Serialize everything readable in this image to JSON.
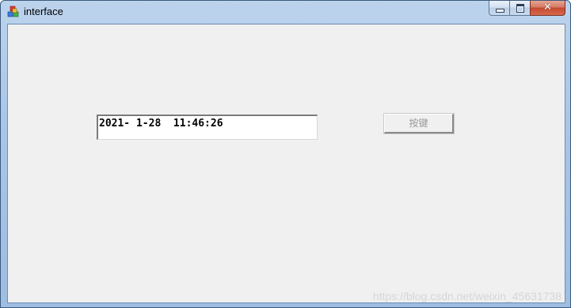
{
  "window": {
    "title": "interface",
    "icon": "app-cubes-icon",
    "caption_buttons": {
      "minimize": "minimize-icon",
      "maximize": "maximize-icon",
      "close_glyph": "✕"
    }
  },
  "form": {
    "datetime_value": "2021- 1-28  11:46:26",
    "button_label": "按键"
  },
  "watermark": "https://blog.csdn.net/weixin_45631738",
  "colors": {
    "titlebar": "#a9c6e7",
    "client": "#f0f0f0",
    "close_button": "#c4492f",
    "disabled_text": "#9a9a9a"
  }
}
